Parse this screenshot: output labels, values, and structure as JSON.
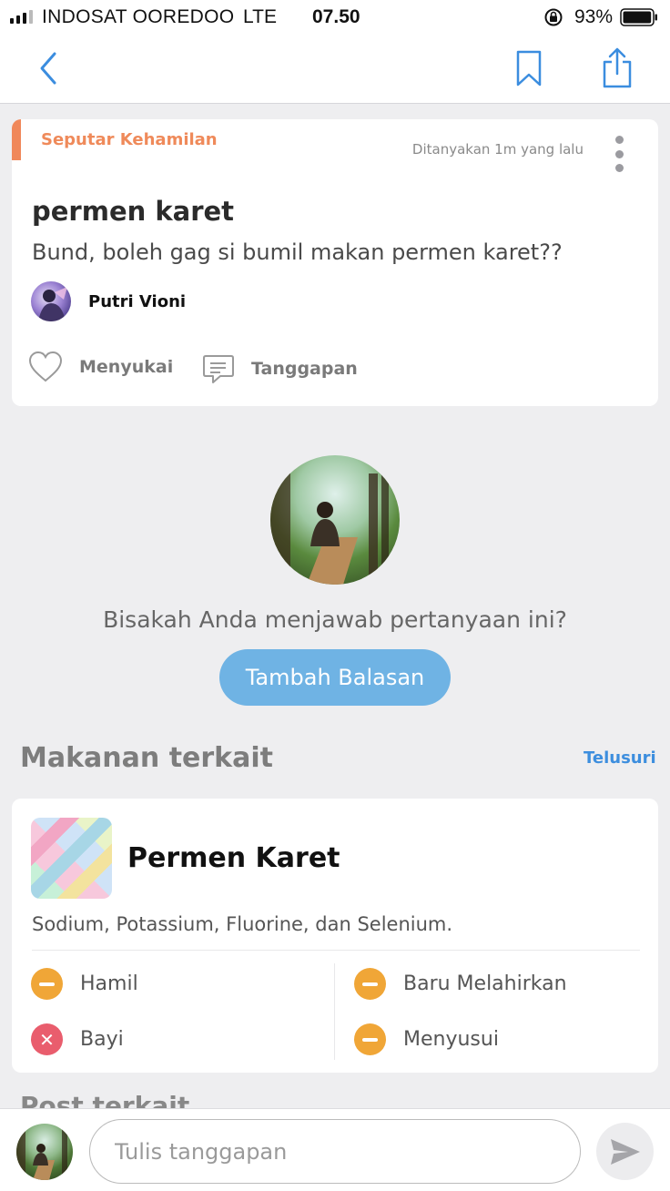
{
  "status_bar": {
    "carrier": "INDOSAT OOREDOO",
    "network": "LTE",
    "time": "07.50",
    "battery": "93%",
    "battery_level": 0.93
  },
  "question": {
    "category": "Seputar Kehamilan",
    "asked": "Ditanyakan 1m yang lalu",
    "title": "permen karet",
    "body": "Bund, boleh gag si bumil makan permen karet??",
    "author": "Putri Vioni",
    "like_label": "Menyukai",
    "reply_label": "Tanggapan"
  },
  "prompt": {
    "text": "Bisakah Anda menjawab pertanyaan ini?",
    "button": "Tambah Balasan"
  },
  "related_food": {
    "section_title": "Makanan terkait",
    "browse": "Telusuri",
    "name": "Permen Karet",
    "nutrients": "Sodium, Potassium, Fluorine, dan Selenium.",
    "statuses": [
      {
        "label": "Hamil",
        "level": "caution"
      },
      {
        "label": "Baru Melahirkan",
        "level": "caution"
      },
      {
        "label": "Bayi",
        "level": "danger"
      },
      {
        "label": "Menyusui",
        "level": "caution"
      }
    ]
  },
  "related_posts": {
    "title": "Post terkait"
  },
  "composer": {
    "placeholder": "Tulis tanggapan"
  },
  "colors": {
    "accent_orange": "#ef8a5a",
    "primary_blue": "#6fb3e4",
    "link_blue": "#3d8ede",
    "caution": "#f0a637",
    "danger": "#e95d6d"
  },
  "icons": {
    "back": "chevron-left-icon",
    "bookmark": "bookmark-icon",
    "share": "share-icon",
    "like": "heart-icon",
    "reply": "comment-icon",
    "send": "send-icon",
    "caution": "minus-circle-icon",
    "danger": "x-circle-icon"
  }
}
